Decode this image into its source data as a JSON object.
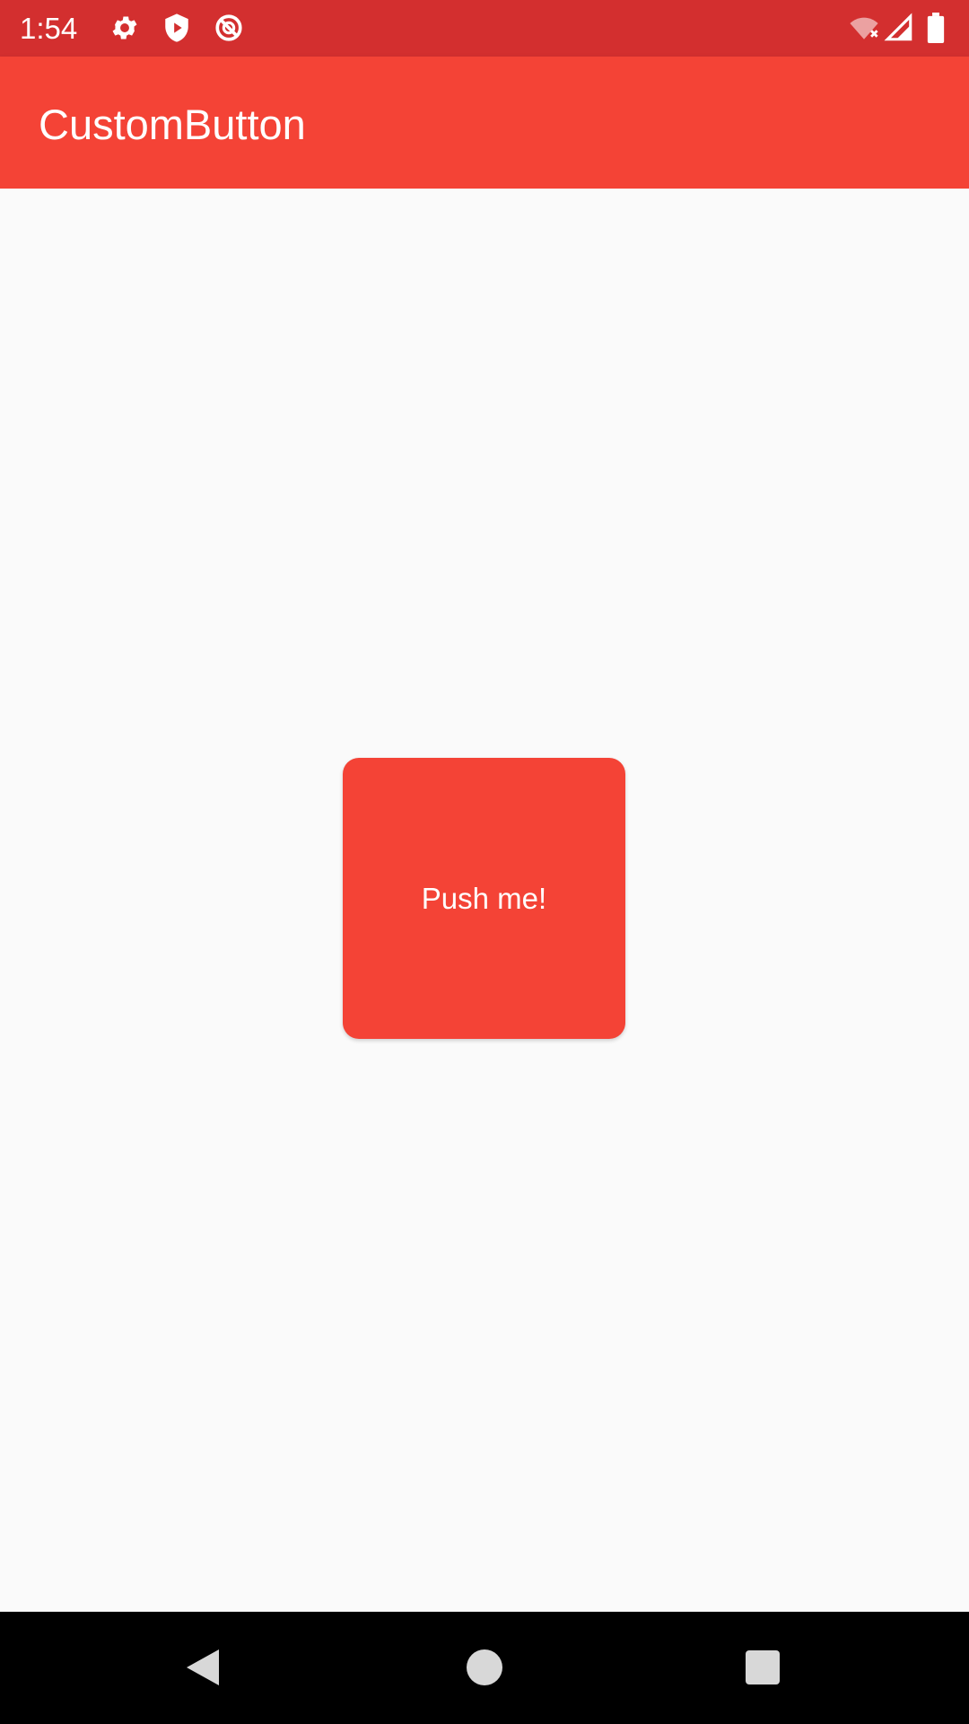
{
  "status_bar": {
    "time": "1:54",
    "background_color": "#d32f2f",
    "left_icons": [
      "settings-gear-icon",
      "shield-play-icon",
      "do-not-disturb-icon"
    ],
    "right_icons": [
      "wifi-no-connection-icon",
      "cell-signal-icon",
      "battery-icon"
    ]
  },
  "app_bar": {
    "title": "CustomButton",
    "background_color": "#f44336"
  },
  "main": {
    "button_label": "Push me!",
    "button_color": "#f44336"
  },
  "nav_bar": {
    "buttons": [
      "back-icon",
      "home-icon",
      "recents-icon"
    ]
  }
}
